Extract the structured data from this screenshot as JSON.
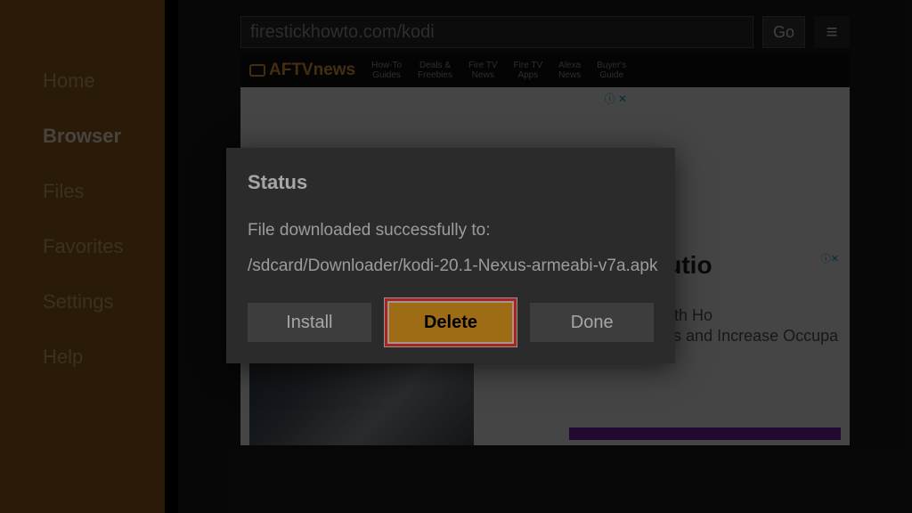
{
  "sidebar": {
    "items": [
      {
        "label": "Home"
      },
      {
        "label": "Browser"
      },
      {
        "label": "Files"
      },
      {
        "label": "Favorites"
      },
      {
        "label": "Settings"
      },
      {
        "label": "Help"
      }
    ],
    "active_index": 1
  },
  "topbar": {
    "url": "firestickhowto.com/kodi",
    "go_label": "Go",
    "menu_glyph": "≡"
  },
  "aftv": {
    "brand": "AFTVnews",
    "nav": [
      "How-To\nGuides",
      "Deals &\nFreebies",
      "Fire TV\nNews",
      "Fire TV\nApps",
      "Alexa\nNews",
      "Buyer's\nGuide"
    ]
  },
  "page": {
    "ad_marker": "ⓘ ✕",
    "headline": "l Distributio",
    "subtext_line1": "operty Now with Ho",
    "subtext_line2": "Global Markets and Increase Occupa",
    "ad_marker2": "ⓘ✕"
  },
  "dialog": {
    "title": "Status",
    "message": "File downloaded successfully to:",
    "path": "/sdcard/Downloader/kodi-20.1-Nexus-armeabi-v7a.apk",
    "buttons": {
      "install": "Install",
      "delete": "Delete",
      "done": "Done"
    },
    "highlighted": "delete"
  }
}
